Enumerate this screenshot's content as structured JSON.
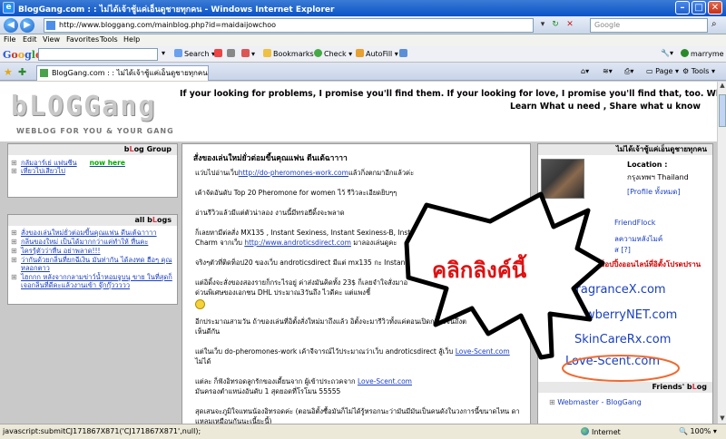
{
  "window": {
    "title": "BlogGang.com : : ไม่ได้เจ้าชู้แค่เอ็นดูชายทุกคน - Windows Internet Explorer"
  },
  "address": {
    "url": "http://www.bloggang.com/mainblog.php?id=maidaijowchoo",
    "search_placeholder": "Google"
  },
  "menu": [
    "File",
    "Edit",
    "View",
    "Favorites",
    "Tools",
    "Help"
  ],
  "google_toolbar": {
    "search_label": "Search",
    "bookmarks_label": "Bookmarks",
    "check_label": "Check",
    "autofill_label": "AutoFill",
    "user_label": "marryme"
  },
  "tab": {
    "title": "BlogGang.com : : ไม่ได้เจ้าชู้แค่เอ็นดูชายทุกคน"
  },
  "commands": {
    "page_label": "Page",
    "tools_label": "Tools"
  },
  "blog_header": {
    "logo": "bLOGGang",
    "tagline": "WEBLOG FOR YOU & YOUR GANG",
    "quote_line1": "If your looking for problems, I promise you'll find them. If your looking for love, I promise you'll find that, too. What are you looking for?",
    "quote_line2": "Learn What u need , Share what u know"
  },
  "left": {
    "group_head_prefix": "b",
    "group_head_accent": "L",
    "group_head_suffix": "og Group",
    "group_items": [
      "กลัมอาร์เย่ แฟนซีน",
      "เที่ยวไปเสียวไป"
    ],
    "now_here": "now here",
    "all_head_prefix": "all b",
    "all_head_accent": "L",
    "all_head_suffix": "ogs",
    "all_items": [
      "สั่งของเล่นใหม่ยั่วต่อมขี้นคุณแฟน ดีนเต้ฉาาาา",
      "กลิ่นของใหม่ เป็นได้มากกว่าแค่ทำให้ หื่นคะ",
      "ไครรู้ตัวว่าหื่น อย่าพลาด!!!",
      "ว่ากันด้วยกลิ่นที่ยกฉีเงิน มันท่ากัน ได้ลงทด ฮือๆ คุณหลอกตาว",
      "ไฮกกก หลังจากกลามข่าว์น้ำหอมจูบนุ ขาย ในที่สุดก็เจอกลิ่นที่ดีคะแล้วงานเข้า จุ๊กกุ๊ววววว"
    ]
  },
  "post": {
    "title": "สั่งของเล่นใหม่ยั่วต่อมขี้นคุณแฟน ดีนเต้ฉาาาา",
    "p1_pre": "แว่บไปอ่านเว็บ",
    "p1_link": "http://do-pheromones-work.com",
    "p1_post": "แล้วกิ่งตกมาอีกแล้วค่ะ",
    "p2": "เค้าจัดอันดับ Top 20 Pheromone for women ไว้ รีวิวละเอียดยิบๆๆ",
    "p3": "อ่านรีวิวแล้วมีแต่ตัวน่าลอง งานนี้มีทรอยืดิ้งจะพลาด",
    "p4a": "ก็เลยหามีต่ลสั่ง MX135 , Instant Sexiness, Instant Sexiness-B, Instant",
    "p4b_pre": "Charm จากเว็บ",
    "p4b_link": "http://www.androticsdirect.com",
    "p4b_post": "มาลองเล่นดูคะ",
    "p5": "จริงๆตัวที่ติดท็อป20 ของเว็บ androticsdirect มีแต่ mx135 กะ Instant",
    "p6a": "แต่อิดิ้งจะสั่งของสองรายก็กระไรอยู่ ค่าส่งมันคิดทั้ง 23$ ก็เลยจำใจสั่งมาอ",
    "p6b": "ด่วนพิเศษของเอกชน DHL ประมาณ3วันถึง ไวดีคะ แต่แพงชี้",
    "p7a": "อีกประมาณสามวัน ถ้าของเล่นที่อิตั้งสั่งใหม่มาถึงแล้ว อิตั้งจะมารีวิวทั้งแค่ตอนเปิดกล่องจนถึงต",
    "p7b": "เห็นดีกัน",
    "p8_pre": "แต่ในเว็บ do-pheromones-work เค้าจีจารณ์ไว้ประมาณว่าเว็บ androticsdirect สู้เว็บ",
    "p8_link": "Love-Scent.com",
    "p8b": "ไม่ได้",
    "p9_pre": "แต่ละ ก็ฟังอิทรอดลูกรักของเดี้ยนจาก ผู้เข้าประถวคจาก",
    "p9_link": "Love-Scent.com",
    "p9b": "มันครองตำแหน่งอันดับ 1 สุดยอดที่โรโมน 55555",
    "p10a": "สุดเสนจะภูมิใจแทนน้องอิทรอดค่ะ (ตอนอิตั้งซื้อมันก็ไม่ได้รู้หรอกนะว่ามันมีมันเป็นคนดังในวงการนี้ขนาดไหน ดา",
    "p10b": "แหลมเหมือนกันนะเนี้ยะนี้)"
  },
  "right": {
    "profile_head": "ไม่ได้เจ้าชู้แค่เอ็นดูชายทุกคน",
    "location_label": "Location :",
    "location_value": "กรุงเทพฯ Thailand",
    "profile_link": "[Profile ทั้งหมด]",
    "friendflock": "FriendFlock",
    "fb_link": "ลความหลังไมค์",
    "qmark": "ส [?]",
    "shop_head": "ช็อปปิ้งออนไลน์ที่อิตั้งโปรดปราน",
    "shops": [
      "FragranceX.com",
      "awberryNET.com",
      "SkinCareRx.com",
      "Love-Scent.com"
    ],
    "friends_head_prefix": "Friends' b",
    "friends_head_accent": "L",
    "friends_head_suffix": "og",
    "friend1": "Webmaster - BlogGang"
  },
  "overlay": {
    "bubble_text": "คลิกลิงค์นี้"
  },
  "statusbar": {
    "text": "javascript:submitCJ171867X871('CJ171867X871',null);",
    "zone": "Internet",
    "zoom": "100%"
  }
}
